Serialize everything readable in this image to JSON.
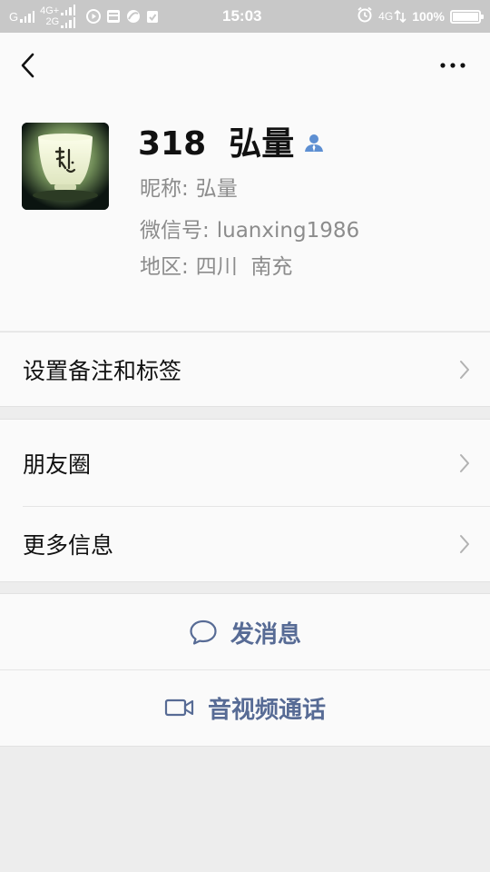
{
  "status_bar": {
    "sim1_network": "G",
    "sim2_network_top": "4G+",
    "sim2_network_bottom": "2G",
    "time": "15:03",
    "right_network": "4G",
    "battery_text": "100%",
    "battery_level": 1.0
  },
  "header": {
    "back_icon": "chevron-left-icon",
    "more_icon": "more-dots-icon"
  },
  "profile": {
    "display_name": "318  弘量",
    "badge_icon": "contact-person-icon",
    "nickname_label": "昵称:",
    "nickname_value": "弘量",
    "wechat_id_label": "微信号:",
    "wechat_id_value": "luanxing1986",
    "region_label": "地区:",
    "region_value": "四川  南充"
  },
  "menu": {
    "remark_tags": "设置备注和标签",
    "moments": "朋友圈",
    "more_info": "更多信息"
  },
  "actions": {
    "message": "发消息",
    "message_icon": "chat-bubble-icon",
    "call": "音视频通话",
    "call_icon": "video-camera-icon"
  },
  "colors": {
    "link_blue": "#576b95",
    "badge_blue": "#5d8fd2",
    "status_bar_bg": "#c8c8c8",
    "page_bg": "#ededed"
  }
}
